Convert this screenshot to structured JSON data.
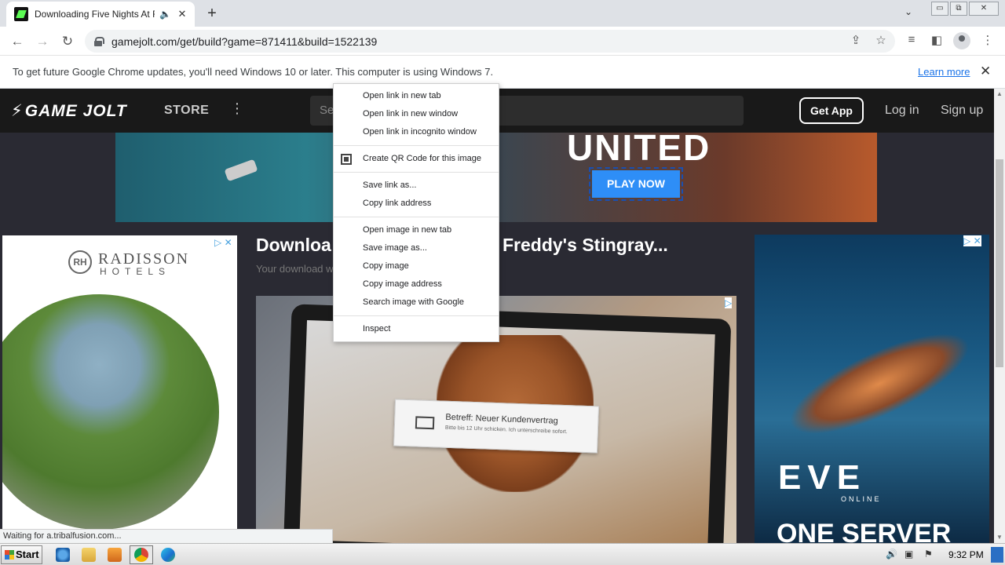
{
  "browser": {
    "tab_title": "Downloading Five Nights At Freddy's Stingray...",
    "url": "gamejolt.com/get/build?game=871411&build=1522139",
    "icons": {
      "favicon": "gamejolt-favicon",
      "audio": "speaker-icon",
      "tab_close": "close-icon",
      "new_tab": "plus-icon",
      "tab_search": "chevron-down-icon",
      "back": "arrow-left-icon",
      "forward": "arrow-right-icon",
      "reload": "reload-icon",
      "lock": "lock-icon",
      "share": "share-icon",
      "bookmark": "star-icon",
      "media": "media-control-icon",
      "side_panel": "side-panel-icon",
      "profile": "profile-icon",
      "menu": "kebab-menu-icon"
    }
  },
  "window_controls": {
    "minimize": "▭",
    "restore": "⧉",
    "close": "✕"
  },
  "infobar": {
    "message": "To get future Google Chrome updates, you'll need Windows 10 or later. This computer is using Windows 7.",
    "learn_more": "Learn more",
    "close": "✕"
  },
  "gamejolt": {
    "logo": "GAME JOLT",
    "store": "STORE",
    "search_placeholder": "Se",
    "get_app": "Get App",
    "login": "Log in",
    "signup": "Sign up"
  },
  "banner": {
    "headline": "UNITED",
    "cta": "PLAY NOW"
  },
  "page": {
    "title_left": "Downloa",
    "title_right": "Freddy's Stingray...",
    "subtitle": "Your download w"
  },
  "ad_left": {
    "brand_mark": "RH",
    "brand": "RADISSON",
    "subbrand": "HOTELS",
    "badge": "▷ ✕"
  },
  "ad_middle": {
    "mail_subject": "Betreff: Neuer Kundenvertrag",
    "mail_body": "Bitte bis 12 Uhr schicken. Ich unterschreibe sofort.",
    "badge": "▷"
  },
  "ad_right": {
    "brand": "EVE",
    "brand_sub": "ONLINE",
    "tagline": "ONE SERVER",
    "badge": "▷ ✕"
  },
  "context_menu": {
    "groups": [
      [
        "Open link in new tab",
        "Open link in new window",
        "Open link in incognito window"
      ],
      [
        "Create QR Code for this image"
      ],
      [
        "Save link as...",
        "Copy link address"
      ],
      [
        "Open image in new tab",
        "Save image as...",
        "Copy image",
        "Copy image address",
        "Search image with Google"
      ],
      [
        "Inspect"
      ]
    ]
  },
  "status": "Waiting for a.tribalfusion.com...",
  "taskbar": {
    "start": "Start",
    "clock": "9:32 PM",
    "apps": [
      "internet-explorer-icon",
      "folder-icon",
      "media-player-icon",
      "chrome-icon",
      "edge-icon"
    ]
  },
  "colors": {
    "gamejolt_accent": "#5cfb54",
    "play_now": "#2e8ef7",
    "link": "#1a73e8"
  }
}
